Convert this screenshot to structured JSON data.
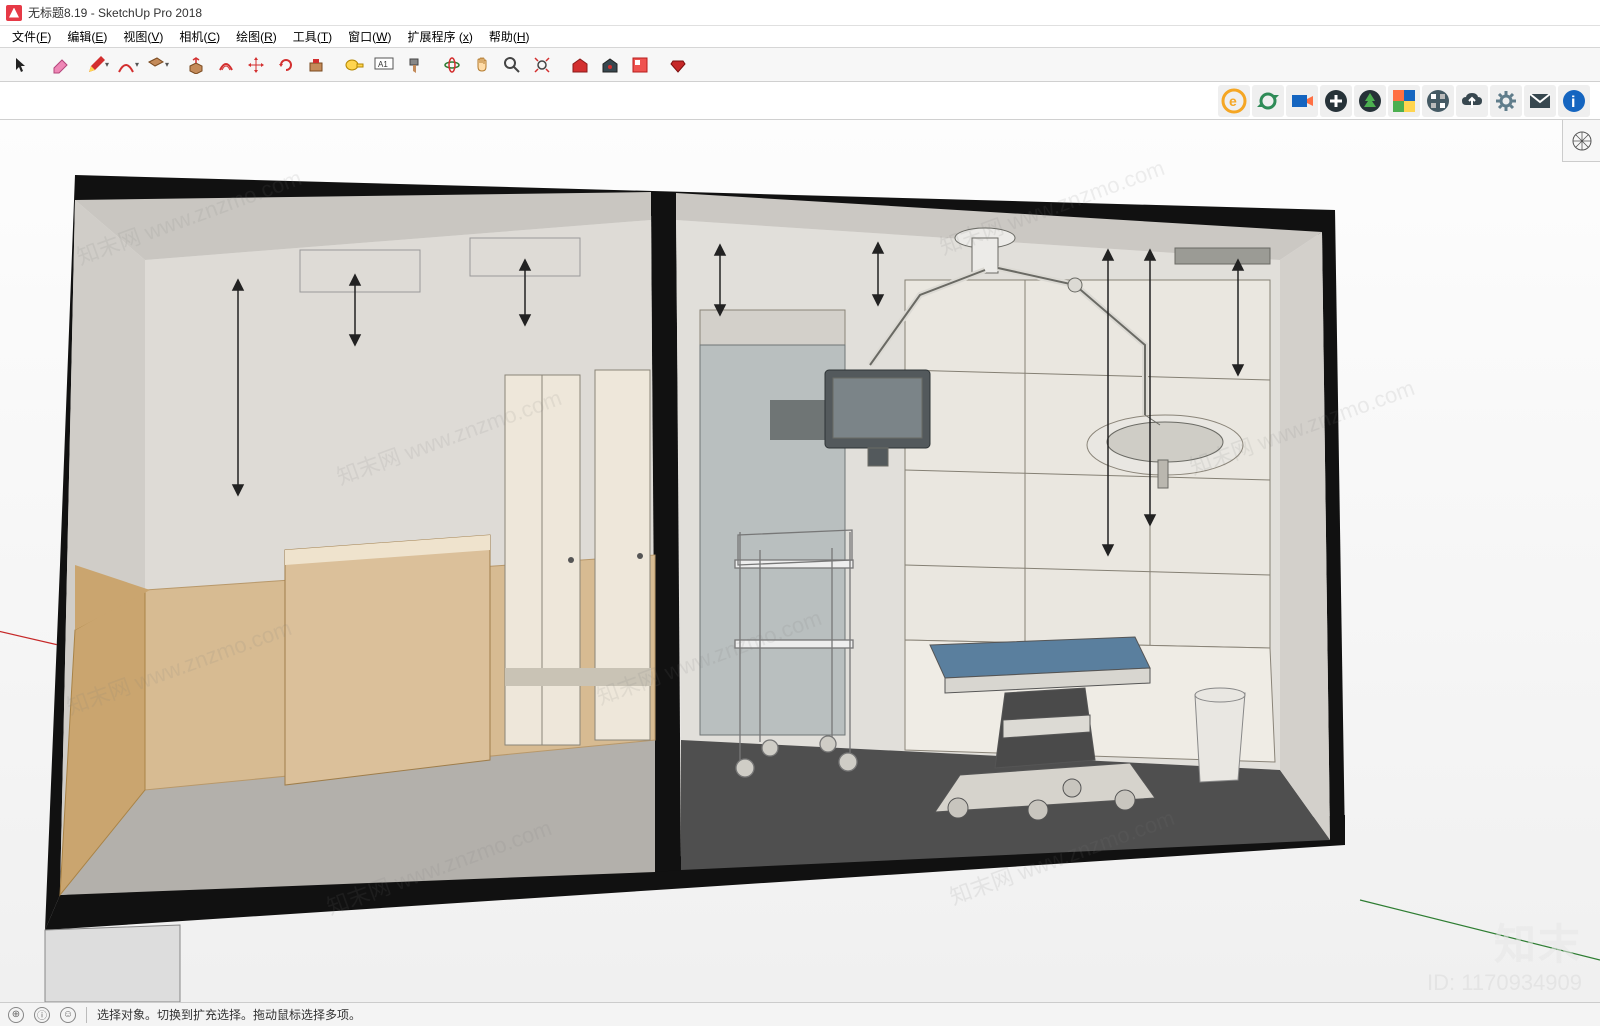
{
  "window": {
    "title": "无标题8.19 - SketchUp Pro 2018"
  },
  "menu": {
    "items": [
      {
        "label": "文件",
        "key": "F"
      },
      {
        "label": "编辑",
        "key": "E"
      },
      {
        "label": "视图",
        "key": "V"
      },
      {
        "label": "相机",
        "key": "C"
      },
      {
        "label": "绘图",
        "key": "R"
      },
      {
        "label": "工具",
        "key": "T"
      },
      {
        "label": "窗口",
        "key": "W"
      },
      {
        "label": "扩展程序",
        "key": "x"
      },
      {
        "label": "帮助",
        "key": "H"
      }
    ]
  },
  "toolbar_main": {
    "items": [
      {
        "name": "select-tool",
        "icon": "cursor"
      },
      {
        "name": "eraser-tool",
        "icon": "eraser"
      },
      {
        "name": "line-tool",
        "icon": "pencil"
      },
      {
        "name": "arc-tool",
        "icon": "arc"
      },
      {
        "name": "rectangle-tool",
        "icon": "rect"
      },
      {
        "name": "circle-tool",
        "icon": "circle"
      },
      {
        "name": "pushpull-tool",
        "icon": "pushpull"
      },
      {
        "name": "offset-tool",
        "icon": "offset"
      },
      {
        "name": "move-tool",
        "icon": "move"
      },
      {
        "name": "rotate-tool",
        "icon": "rotate"
      },
      {
        "name": "scale-tool",
        "icon": "scale"
      },
      {
        "name": "tape-tool",
        "icon": "tape"
      },
      {
        "name": "text-tool",
        "icon": "text"
      },
      {
        "name": "paint-tool",
        "icon": "paint"
      },
      {
        "name": "orbit-tool",
        "icon": "orbit"
      },
      {
        "name": "pan-tool",
        "icon": "pan"
      },
      {
        "name": "zoom-tool",
        "icon": "zoom"
      },
      {
        "name": "zoom-extents-tool",
        "icon": "zoomext"
      },
      {
        "name": "warehouse-tool",
        "icon": "box-red"
      },
      {
        "name": "extension-tool",
        "icon": "box-dark"
      },
      {
        "name": "layout-tool",
        "icon": "layout"
      },
      {
        "name": "enscape-tool",
        "icon": "ruby"
      }
    ]
  },
  "plugin_bar": {
    "items": [
      {
        "name": "plugin-e-icon",
        "glyph": "e",
        "color": "#f5a623"
      },
      {
        "name": "plugin-sync-icon",
        "glyph": "sync",
        "color": "#2e8b57"
      },
      {
        "name": "plugin-camera-icon",
        "glyph": "cam",
        "color": "#1565c0"
      },
      {
        "name": "plugin-add-icon",
        "glyph": "plus",
        "color": "#263238"
      },
      {
        "name": "plugin-tree-icon",
        "glyph": "tree",
        "color": "#2e7d32"
      },
      {
        "name": "plugin-palette-icon",
        "glyph": "pal",
        "color": "#ff7043"
      },
      {
        "name": "plugin-checker-icon",
        "glyph": "chk",
        "color": "#455a64"
      },
      {
        "name": "plugin-cloud-icon",
        "glyph": "cloud",
        "color": "#37474f"
      },
      {
        "name": "plugin-gear-icon",
        "glyph": "gear",
        "color": "#607d8b"
      },
      {
        "name": "plugin-mail-icon",
        "glyph": "mail",
        "color": "#37474f"
      },
      {
        "name": "plugin-info-icon",
        "glyph": "info",
        "color": "#1565c0"
      }
    ]
  },
  "right_dock": {
    "icon_name": "view-cube-icon"
  },
  "statusbar": {
    "icons": [
      "geo-location-icon",
      "credits-icon",
      "profile-icon"
    ],
    "hint": "选择对象。切换到扩充选择。拖动鼠标选择多项。"
  },
  "viewport": {
    "watermark_text": "知末网 www.znzmo.com",
    "brand": "知末",
    "asset_id": "ID: 1170934909",
    "scene_description": "Section view of two adjacent rooms: left room is a corridor/waiting area with tan wainscot and two doors; right room is an operating room with ceiling-mounted surgical light arm, monitor, operating table, instrument trolley, bin, and wall cabinets."
  }
}
